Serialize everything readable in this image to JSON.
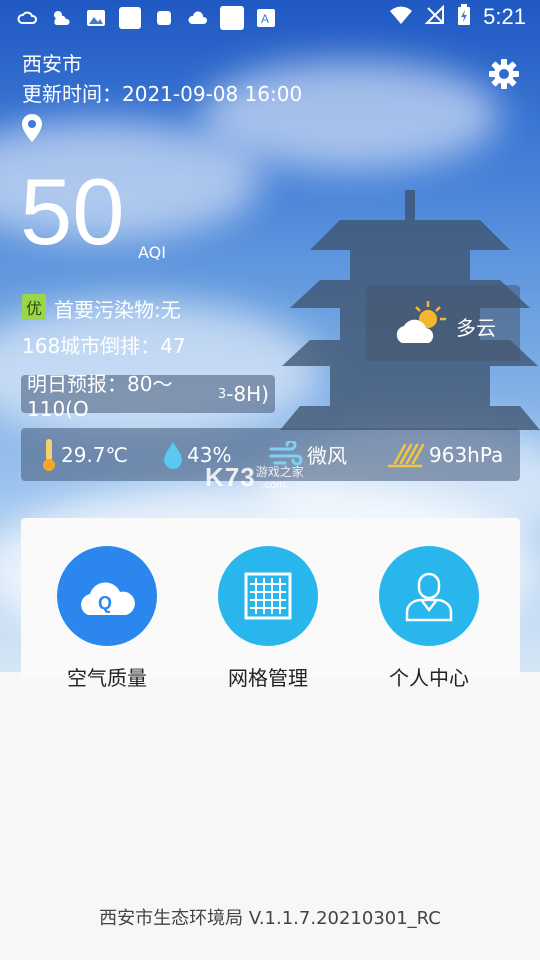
{
  "status_bar": {
    "time": "5:21",
    "left_icons": [
      "cloud-sun-icon",
      "weather-icon",
      "image-icon",
      "app-icon",
      "app-icon",
      "cloud-icon",
      "app-icon",
      "font-icon"
    ],
    "right_icons": [
      "wifi-icon",
      "no-signal-icon",
      "battery-charging-icon"
    ]
  },
  "header": {
    "city": "西安市",
    "update_label": "更新时间：2021-09-08 16:00"
  },
  "aqi": {
    "value": "50",
    "unit": "AQI",
    "level": "优",
    "level_color": "#9bd54a",
    "primary_pollutant": "首要污染物:无",
    "rank": "168城市倒排：47"
  },
  "forecast": {
    "prefix": "明日预报：80～110(O",
    "sub": "3",
    "suffix": "-8H)"
  },
  "weather": {
    "condition": "多云"
  },
  "metrics": {
    "temperature": "29.7℃",
    "humidity": "43%",
    "wind": "微风",
    "pressure": "963hPa"
  },
  "watermark": {
    "brand": "K73",
    "sub": "游戏之家",
    "domain": ".com"
  },
  "features": [
    {
      "label": "空气质量",
      "icon": "cloud-q-icon",
      "color": "#2b86ee"
    },
    {
      "label": "网格管理",
      "icon": "grid-icon",
      "color": "#29b6ec"
    },
    {
      "label": "个人中心",
      "icon": "person-icon",
      "color": "#29b6ec"
    }
  ],
  "footer": {
    "text": "西安市生态环境局 V.1.1.7.20210301_RC"
  }
}
